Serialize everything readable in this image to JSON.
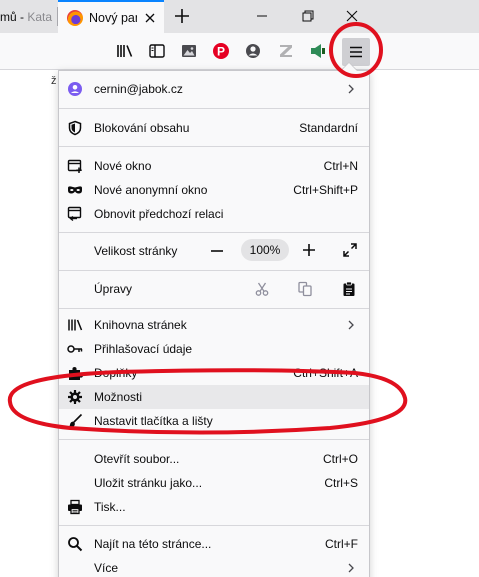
{
  "tabs": {
    "previous_tab_text_a": "mů - ",
    "previous_tab_text_b": "Kata",
    "active_tab_title": "Nový panel"
  },
  "page_fragment": "ž",
  "menu": {
    "account": {
      "email": "cernin@jabok.cz"
    },
    "content_blocking": {
      "label": "Blokování obsahu",
      "value": "Standardní"
    },
    "new_window": {
      "label": "Nové okno",
      "shortcut": "Ctrl+N"
    },
    "private_window": {
      "label": "Nové anonymní okno",
      "shortcut": "Ctrl+Shift+P"
    },
    "restore_session": {
      "label": "Obnovit předchozí relaci"
    },
    "zoom": {
      "label": "Velikost stránky",
      "value": "100%"
    },
    "edit": {
      "label": "Úpravy"
    },
    "library": {
      "label": "Knihovna stránek"
    },
    "logins": {
      "label": "Přihlašovací údaje"
    },
    "addons": {
      "label": "Doplňky",
      "shortcut": "Ctrl+Shift+A"
    },
    "options": {
      "label": "Možnosti"
    },
    "customize": {
      "label": "Nastavit tlačítka a lišty"
    },
    "open_file": {
      "label": "Otevřít soubor...",
      "shortcut": "Ctrl+O"
    },
    "save_page": {
      "label": "Uložit stránku jako...",
      "shortcut": "Ctrl+S"
    },
    "print": {
      "label": "Tisk..."
    },
    "find": {
      "label": "Najít na této stránce...",
      "shortcut": "Ctrl+F"
    },
    "more": {
      "label": "Více"
    }
  },
  "colors": {
    "annotation_red": "#e0101e",
    "accent_blue": "#0a84ff",
    "pinterest_red": "#e60023",
    "account_icon_purple": "#7b5cf0"
  },
  "icons": [
    "firefox-icon",
    "close-icon",
    "plus-icon",
    "minimize-icon",
    "restore-icon",
    "library-icon",
    "sidebar-icon",
    "image-icon",
    "pinterest-icon",
    "account-icon",
    "zotero-icon",
    "extension-icon",
    "hamburger-menu-icon",
    "shield-icon",
    "new-window-icon",
    "mask-icon",
    "restore-session-icon",
    "minus-icon",
    "fullscreen-icon",
    "scissors-icon",
    "copy-icon",
    "paste-icon",
    "key-icon",
    "puzzle-icon",
    "gear-icon",
    "paintbrush-icon",
    "printer-icon",
    "search-icon",
    "chevron-right-icon"
  ]
}
